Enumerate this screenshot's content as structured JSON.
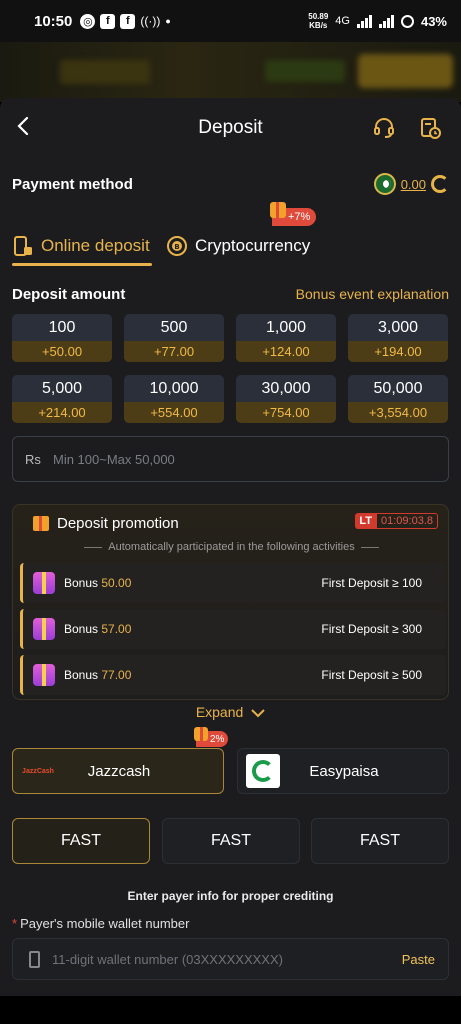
{
  "status_bar": {
    "time": "10:50",
    "speed_value": "50.89",
    "speed_unit": "KB/s",
    "network": "4G",
    "battery": "43%"
  },
  "header": {
    "title": "Deposit"
  },
  "payment_method": {
    "label": "Payment method",
    "balance": "0.00"
  },
  "tabs": [
    {
      "label": "Online deposit",
      "active": true
    },
    {
      "label": "Cryptocurrency",
      "active": false
    }
  ],
  "crypto_badge": "+7%",
  "deposit_amount": {
    "label": "Deposit amount",
    "bonus_link": "Bonus event explanation"
  },
  "amounts": [
    {
      "value": "100",
      "bonus": "+50.00"
    },
    {
      "value": "500",
      "bonus": "+77.00"
    },
    {
      "value": "1,000",
      "bonus": "+124.00"
    },
    {
      "value": "3,000",
      "bonus": "+194.00"
    },
    {
      "value": "5,000",
      "bonus": "+214.00"
    },
    {
      "value": "10,000",
      "bonus": "+554.00"
    },
    {
      "value": "30,000",
      "bonus": "+754.00"
    },
    {
      "value": "50,000",
      "bonus": "+3,554.00"
    }
  ],
  "amount_input": {
    "currency": "Rs",
    "placeholder": "Min 100~Max 50,000"
  },
  "promotion": {
    "title": "Deposit promotion",
    "timer_label": "LT",
    "timer": "01:09:03.8",
    "subtitle": "Automatically participated in the following activities",
    "rows": [
      {
        "label": "Bonus",
        "amount": "50.00",
        "condition": "First Deposit ≥ 100"
      },
      {
        "label": "Bonus",
        "amount": "57.00",
        "condition": "First Deposit ≥ 300"
      },
      {
        "label": "Bonus",
        "amount": "77.00",
        "condition": "First Deposit ≥ 500"
      }
    ]
  },
  "expand_label": "Expand",
  "channels": [
    {
      "name": "Jazzcash",
      "logo_text": "JazzCash",
      "selected": true
    },
    {
      "name": "Easypaisa",
      "selected": false
    }
  ],
  "channel_badge": "2%",
  "fast_options": [
    "FAST",
    "FAST",
    "FAST"
  ],
  "payer_hint": "Enter payer info for proper crediting",
  "wallet": {
    "label": "Payer's mobile wallet number",
    "placeholder": "11-digit wallet number (03XXXXXXXXX)",
    "paste": "Paste"
  },
  "colors": {
    "accent": "#e8b34a",
    "badge_red": "#e04a3b",
    "sheet_bg": "#1c1c1f"
  }
}
